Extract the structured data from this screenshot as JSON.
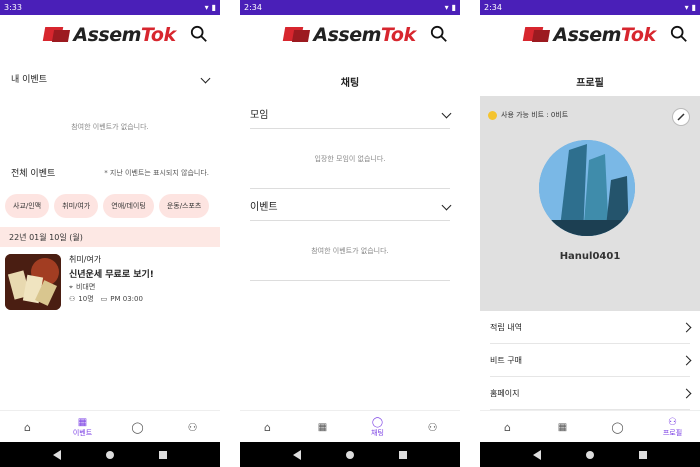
{
  "screens": [
    {
      "status_time": "3:33",
      "brand": {
        "prefix": "Assem",
        "suffix": "Tok"
      },
      "my_events": {
        "label": "내 이벤트",
        "empty": "참여한 이벤트가 없습니다."
      },
      "all_events": {
        "label": "전체 이벤트",
        "note": "* 지난 이벤트는 표시되지 않습니다."
      },
      "categories": [
        "사교/인맥",
        "취미/여가",
        "연애/데이팅",
        "운동/스포츠"
      ],
      "date_header": "22년 01월 10일 (월)",
      "event": {
        "category": "취미/여가",
        "title": "신년운세 무료로 보기!",
        "location": "비대면",
        "people": "10명",
        "time": "PM 03:00"
      },
      "nav": {
        "active_label": "이벤트"
      }
    },
    {
      "status_time": "2:34",
      "brand": {
        "prefix": "Assem",
        "suffix": "Tok"
      },
      "title": "채팅",
      "sections": [
        {
          "label": "모임",
          "empty": "입장한 모임이 없습니다."
        },
        {
          "label": "이벤트",
          "empty": "참여한 이벤트가 없습니다."
        }
      ],
      "nav": {
        "active_label": "채팅"
      }
    },
    {
      "status_time": "2:34",
      "brand": {
        "prefix": "Assem",
        "suffix": "Tok"
      },
      "title": "프로필",
      "points": "사용 가능 비트 : 0비트",
      "username": "Hanul0401",
      "menu": [
        "적립 내역",
        "비트 구매",
        "홈페이지"
      ],
      "nav": {
        "active_label": "프로필"
      }
    }
  ],
  "colors": {
    "status_bar": "#4a1fb8",
    "accent": "#7b3fe4",
    "chip_bg": "#fde4e1",
    "brand_red": "#d7262e"
  }
}
